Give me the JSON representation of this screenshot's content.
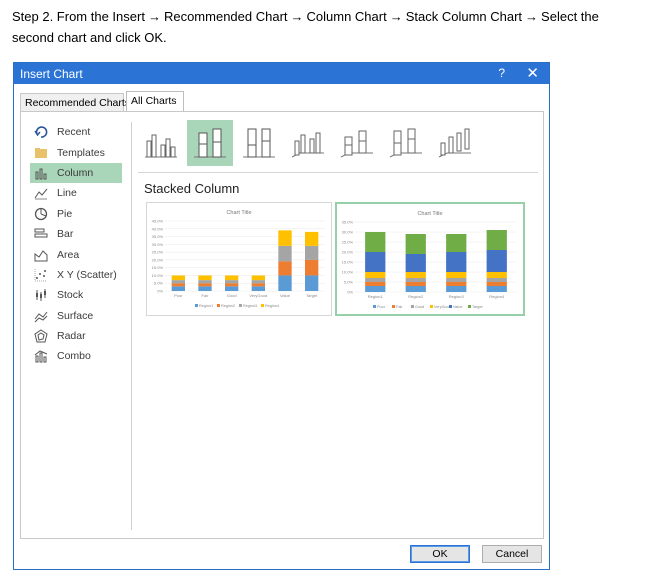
{
  "instruction": {
    "line1_a": "Step 2. From the Insert",
    "line1_b": "Recommended Chart",
    "line1_c": "Column Chart",
    "line1_d": "Stack Column Chart",
    "line1_e": "Select the",
    "line2": "second chart and click OK.",
    "arrow": "→"
  },
  "dialog": {
    "title": "Insert Chart",
    "help": "?",
    "close": "✕",
    "tabs": [
      "Recommended Charts",
      "All Charts"
    ],
    "active_tab": "All Charts",
    "sidebar": [
      {
        "label": "Recent",
        "icon": "recent-icon"
      },
      {
        "label": "Templates",
        "icon": "folder-icon"
      },
      {
        "label": "Column",
        "icon": "column-chart-icon",
        "selected": true
      },
      {
        "label": "Line",
        "icon": "line-chart-icon"
      },
      {
        "label": "Pie",
        "icon": "pie-chart-icon"
      },
      {
        "label": "Bar",
        "icon": "bar-chart-icon"
      },
      {
        "label": "Area",
        "icon": "area-chart-icon"
      },
      {
        "label": "X Y (Scatter)",
        "icon": "scatter-chart-icon"
      },
      {
        "label": "Stock",
        "icon": "stock-chart-icon"
      },
      {
        "label": "Surface",
        "icon": "surface-chart-icon"
      },
      {
        "label": "Radar",
        "icon": "radar-chart-icon"
      },
      {
        "label": "Combo",
        "icon": "combo-chart-icon"
      }
    ],
    "subtype_selected_index": 1,
    "section_title": "Stacked Column",
    "ok_label": "OK",
    "cancel_label": "Cancel",
    "colors": {
      "series1": "#5b9bd5",
      "series2": "#ed7d31",
      "series3": "#a5a5a5",
      "series4": "#ffc000",
      "series5": "#4472c4",
      "series6": "#70ad47"
    }
  },
  "chart_data": [
    {
      "type": "bar",
      "stacked": true,
      "title": "Chart Title",
      "categories": [
        "Poor",
        "Fair",
        "Good",
        "VeryGood",
        "Value",
        "Target"
      ],
      "series": [
        {
          "name": "Region1",
          "values": [
            3,
            3,
            3,
            3,
            10,
            10
          ]
        },
        {
          "name": "Region2",
          "values": [
            2,
            2,
            2,
            2,
            9,
            10
          ]
        },
        {
          "name": "Region3",
          "values": [
            2,
            2,
            2,
            2,
            10,
            9
          ]
        },
        {
          "name": "Region4",
          "values": [
            3,
            3,
            3,
            3,
            10,
            9
          ]
        }
      ],
      "yticks": [
        "45.0%",
        "40.0%",
        "35.0%",
        "30.0%",
        "25.0%",
        "20.0%",
        "15.0%",
        "10.0%",
        "5.0%",
        "0%"
      ],
      "ylim": [
        0,
        45
      ]
    },
    {
      "type": "bar",
      "stacked": true,
      "title": "Chart Title",
      "categories": [
        "Region1",
        "Region2",
        "Region3",
        "Region4"
      ],
      "series": [
        {
          "name": "Poor",
          "values": [
            3,
            3,
            3,
            3
          ]
        },
        {
          "name": "Fair",
          "values": [
            2,
            2,
            2,
            2
          ]
        },
        {
          "name": "Good",
          "values": [
            2,
            2,
            2,
            2
          ]
        },
        {
          "name": "VeryGood",
          "values": [
            3,
            3,
            3,
            3
          ]
        },
        {
          "name": "Value",
          "values": [
            10,
            9,
            10,
            11
          ]
        },
        {
          "name": "Target",
          "values": [
            10,
            10,
            9,
            10
          ]
        }
      ],
      "yticks": [
        "35.0%",
        "30.0%",
        "25.0%",
        "20.0%",
        "15.0%",
        "10.0%",
        "5.0%",
        "0%"
      ],
      "ylim": [
        0,
        35
      ]
    }
  ]
}
